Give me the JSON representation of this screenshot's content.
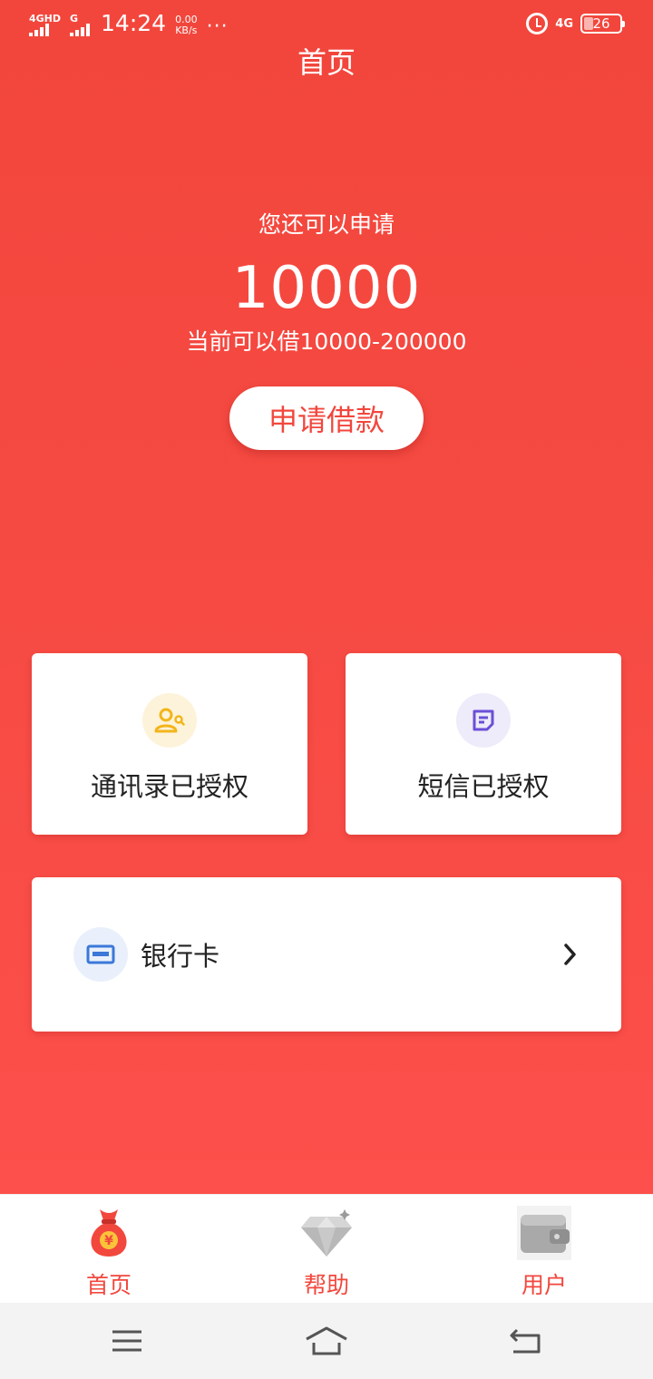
{
  "status_bar": {
    "sim1": "4GHD",
    "sim2": "G",
    "time": "14:24",
    "speed_value": "0.00",
    "speed_unit": "KB/s",
    "more": "···",
    "network": "4G",
    "battery": "26"
  },
  "header": {
    "title": "首页"
  },
  "hero": {
    "subtitle": "您还可以申请",
    "amount": "10000",
    "range_text": "当前可以借10000-200000",
    "apply_button": "申请借款"
  },
  "cards": {
    "contacts_label": "通讯录已授权",
    "sms_label": "短信已授权",
    "bank_label": "银行卡"
  },
  "tabs": [
    {
      "label": "首页",
      "icon": "money-bag-icon",
      "active": true
    },
    {
      "label": "帮助",
      "icon": "diamond-icon",
      "active": false
    },
    {
      "label": "用户",
      "icon": "wallet-icon",
      "active": false
    }
  ],
  "colors": {
    "primary": "#f2473d",
    "contacts_icon": "#f3b51b",
    "sms_icon": "#6b4fd8",
    "bank_icon": "#3b78d8"
  }
}
